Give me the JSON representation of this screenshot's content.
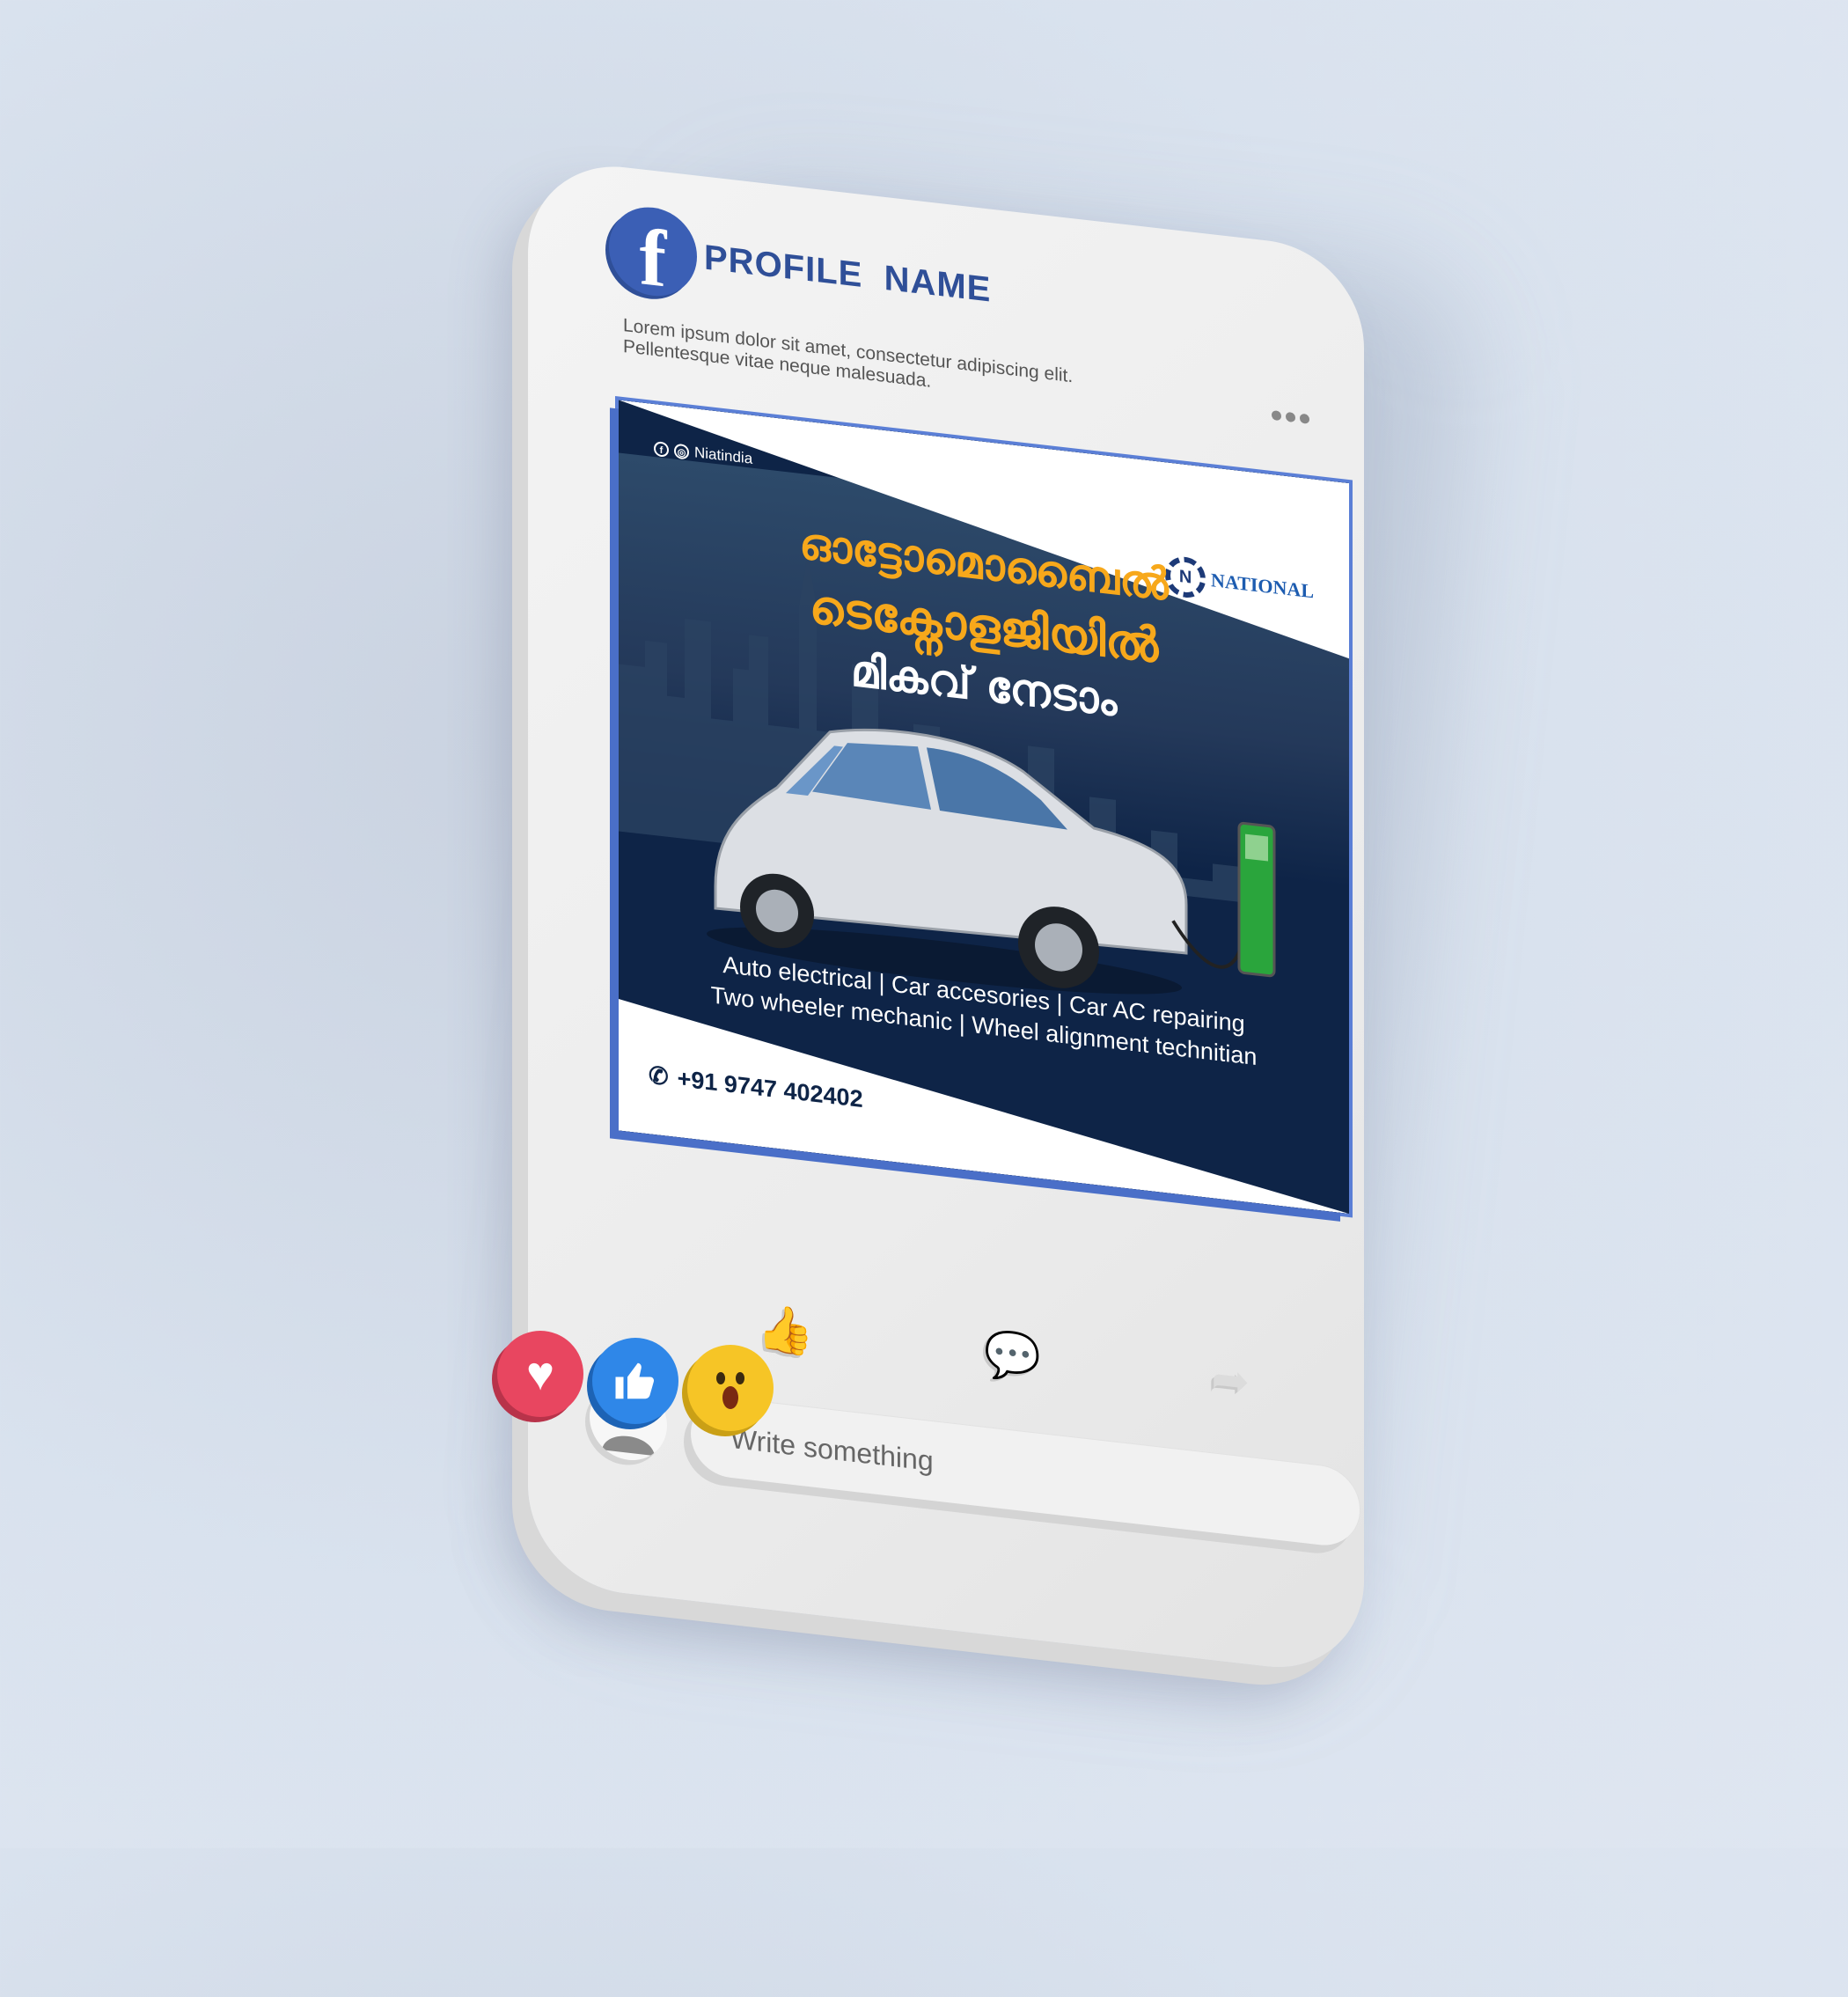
{
  "profile": {
    "name": "PROFILE  NAME",
    "caption": "Lorem ipsum dolor sit amet, consectetur adipiscing elit. Pellentesque vitae neque malesuada."
  },
  "post": {
    "social_handle": "Niatindia",
    "brand": "NATIONAL",
    "headline_line1": "ഓട്ടോമൊബൈൽ",
    "headline_line2": "ടെക്നോളജിയിൽ",
    "headline_line3": "മികവ് നേടാം",
    "services_line1": "Auto electrical | Car accesories | Car AC repairing",
    "services_line2": "Two wheeler mechanic | Wheel alignment technitian",
    "phone": "+91 9747 402402"
  },
  "actions": {
    "like_icon": "thumbs-up-icon",
    "comment_icon": "comment-icon",
    "share_icon": "share-icon"
  },
  "reactions": [
    "heart",
    "like",
    "wow"
  ],
  "comment": {
    "placeholder": "Write something"
  },
  "colors": {
    "facebook_blue": "#3b5fb5",
    "headline_orange": "#f7a81b",
    "post_navy": "#0e2447"
  }
}
